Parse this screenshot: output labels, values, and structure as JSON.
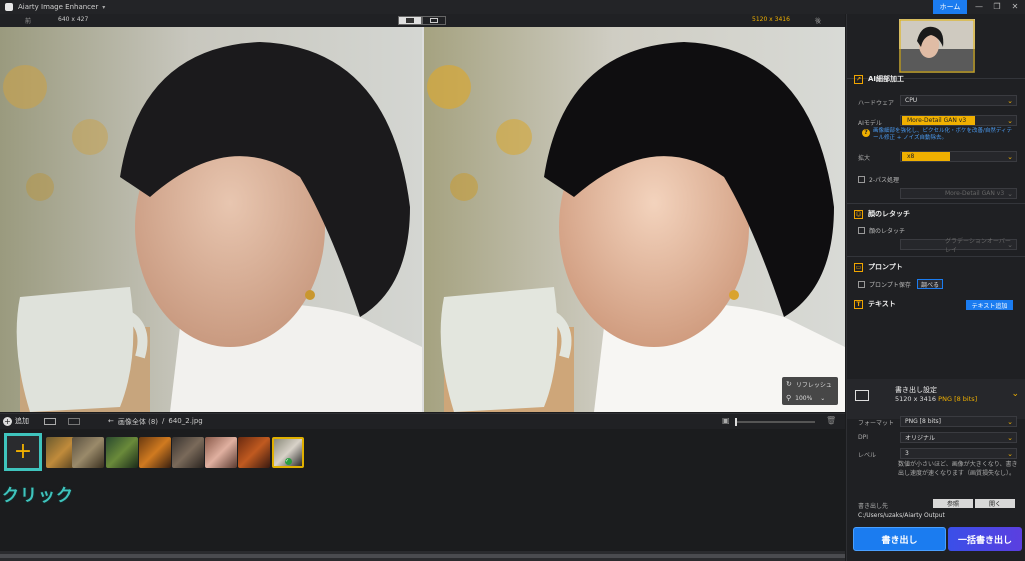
{
  "app": {
    "title": "Aiarty Image Enhancer",
    "home_label": "ホーム"
  },
  "window_controls": {
    "minimize": "—",
    "maximize": "❐",
    "close": "✕"
  },
  "compare": {
    "before_label": "前",
    "after_label": "後",
    "before_size": "640 x 427",
    "after_size": "5120 x 3416"
  },
  "image_controls": {
    "reflection_label": "リフレッシュ",
    "zoom": "100%"
  },
  "bottom_bar": {
    "add_label": "追加",
    "breadcrumb_all": "画像全体 (8)",
    "breadcrumb_sep": "/",
    "breadcrumb_file": "640_2.jpg"
  },
  "thumbnails": {
    "add_symbol": "+",
    "callout_label": "クリック",
    "items": [
      {
        "kind": "tiger",
        "selected": false
      },
      {
        "kind": "reptile",
        "selected": false
      },
      {
        "kind": "insect",
        "selected": false
      },
      {
        "kind": "food",
        "selected": false
      },
      {
        "kind": "dog",
        "selected": false
      },
      {
        "kind": "portrait",
        "selected": false
      },
      {
        "kind": "abstract",
        "selected": false
      },
      {
        "kind": "woman",
        "selected": true
      }
    ]
  },
  "panel": {
    "ai_section": {
      "title": "AI細部加工",
      "hardware_label": "ハードウェア",
      "hardware_value": "CPU",
      "model_label": "AIモデル",
      "model_value": "More-Detail GAN v3",
      "model_note": "画像細部を強化し、ピクセル化・ボケを改善/自然ディテール修正 + ノイズ自動除去。",
      "scale_label": "拡大",
      "scale_value": "x8",
      "twopass_label": "2-パス処理",
      "twopass_value": "More-Detail GAN v3"
    },
    "face_section": {
      "title": "顔のレタッチ",
      "check_label": "顔のレタッチ",
      "select_value": "グラデーションオーバーレイ"
    },
    "prompt_section": {
      "title": "プロンプト",
      "check_label": "プロンプト保存",
      "button_label": "調べる"
    },
    "text_section": {
      "title": "テキスト",
      "add_button": "テキスト追加"
    },
    "export": {
      "title": "書き出し設定",
      "size": "5120 x 3416",
      "format": "PNG",
      "bits": "[8 bits]",
      "format_label": "フォーマット",
      "format_value": "PNG  [8 bits]",
      "dpi_label": "DPI",
      "dpi_value": "オリジナル",
      "level_label": "レベル",
      "level_value": "3",
      "level_desc": "数値が小さいほど、画像が大きくなり、書き出し速度が速くなります（画質損失なし）。",
      "dest_label": "書き出し先",
      "browse_label": "参照",
      "open_label": "開く",
      "path": "C:/Users/uzaks/Aiarty Output",
      "export_button": "書き出し",
      "batch_button": "一括書き出し"
    }
  },
  "colors": {
    "accent": "#1b7cf0",
    "highlight": "#f0b000",
    "callout": "#3fc4bd",
    "export_grad_end": "#5b3fe0"
  }
}
